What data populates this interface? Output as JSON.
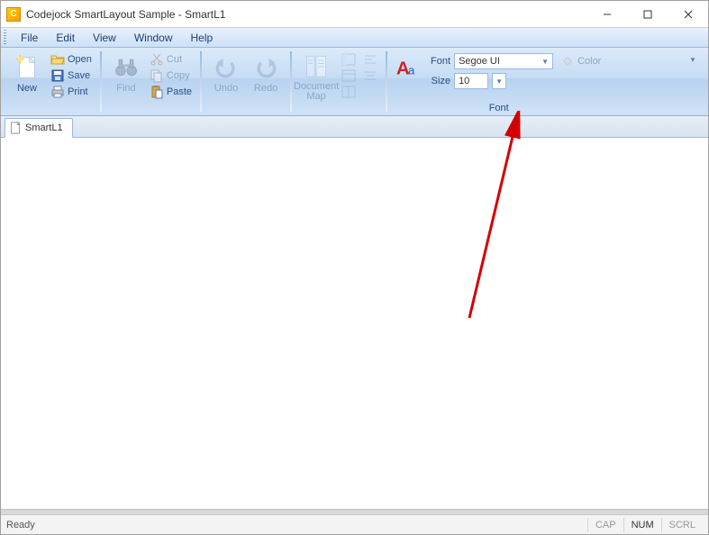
{
  "window": {
    "title": "Codejock SmartLayout Sample - SmartL1"
  },
  "menu": {
    "items": [
      "File",
      "Edit",
      "View",
      "Window",
      "Help"
    ]
  },
  "ribbon": {
    "new": "New",
    "open": "Open",
    "save": "Save",
    "print": "Print",
    "find": "Find",
    "cut": "Cut",
    "copy": "Copy",
    "paste": "Paste",
    "undo": "Undo",
    "redo": "Redo",
    "document_map": "Document\nMap",
    "font_group_label": "Font",
    "font_label": "Font",
    "size_label": "Size",
    "font_value": "Segoe UI",
    "size_value": "10",
    "color": "Color"
  },
  "document": {
    "tab_name": "SmartL1"
  },
  "status": {
    "ready": "Ready",
    "cap": "CAP",
    "num": "NUM",
    "scrl": "SCRL"
  }
}
